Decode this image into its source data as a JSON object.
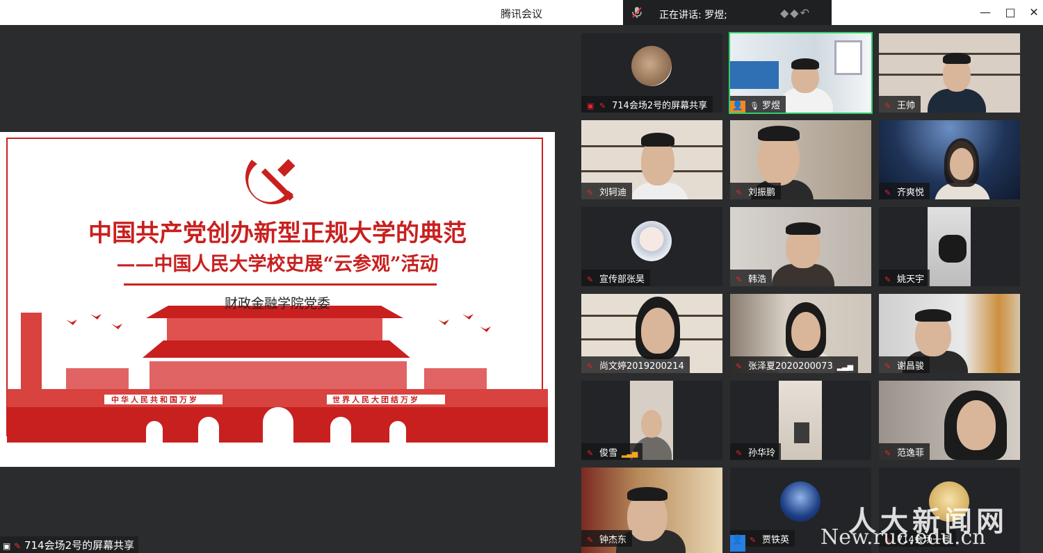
{
  "window": {
    "title": "腾讯会议"
  },
  "speaking": {
    "label": "正在讲话: 罗煜;"
  },
  "controls": {
    "minimize": "—",
    "maximize": "□",
    "close": "✕"
  },
  "slide": {
    "title": "中国共产党创办新型正规大学的典范",
    "subtitle": "——中国人民大学校史展“云参观”活动",
    "org": "财政金融学院党委",
    "banner_left": "中华人民共和国万岁",
    "banner_right": "世界人民大团结万岁"
  },
  "share_label": "714会场2号的屏幕共享",
  "participants": [
    {
      "name": "714会场2号的屏幕共享"
    },
    {
      "name": "罗煜"
    },
    {
      "name": "王帅"
    },
    {
      "name": "刘轲迪"
    },
    {
      "name": "刘振鹏"
    },
    {
      "name": "齐爽悦"
    },
    {
      "name": "宣传部张昊"
    },
    {
      "name": "韩浩"
    },
    {
      "name": "姚天宇"
    },
    {
      "name": "尚文婷2019200214"
    },
    {
      "name": "张泽夏2020200073"
    },
    {
      "name": "谢昌骏"
    },
    {
      "name": "俊雪"
    },
    {
      "name": "孙华玲"
    },
    {
      "name": "范逸菲"
    },
    {
      "name": "钟杰东"
    },
    {
      "name": "贾铁英"
    },
    {
      "name": "714会场一号"
    }
  ],
  "watermark": {
    "cn": "人大新闻网",
    "url": "New.ruc.edu.cn"
  }
}
